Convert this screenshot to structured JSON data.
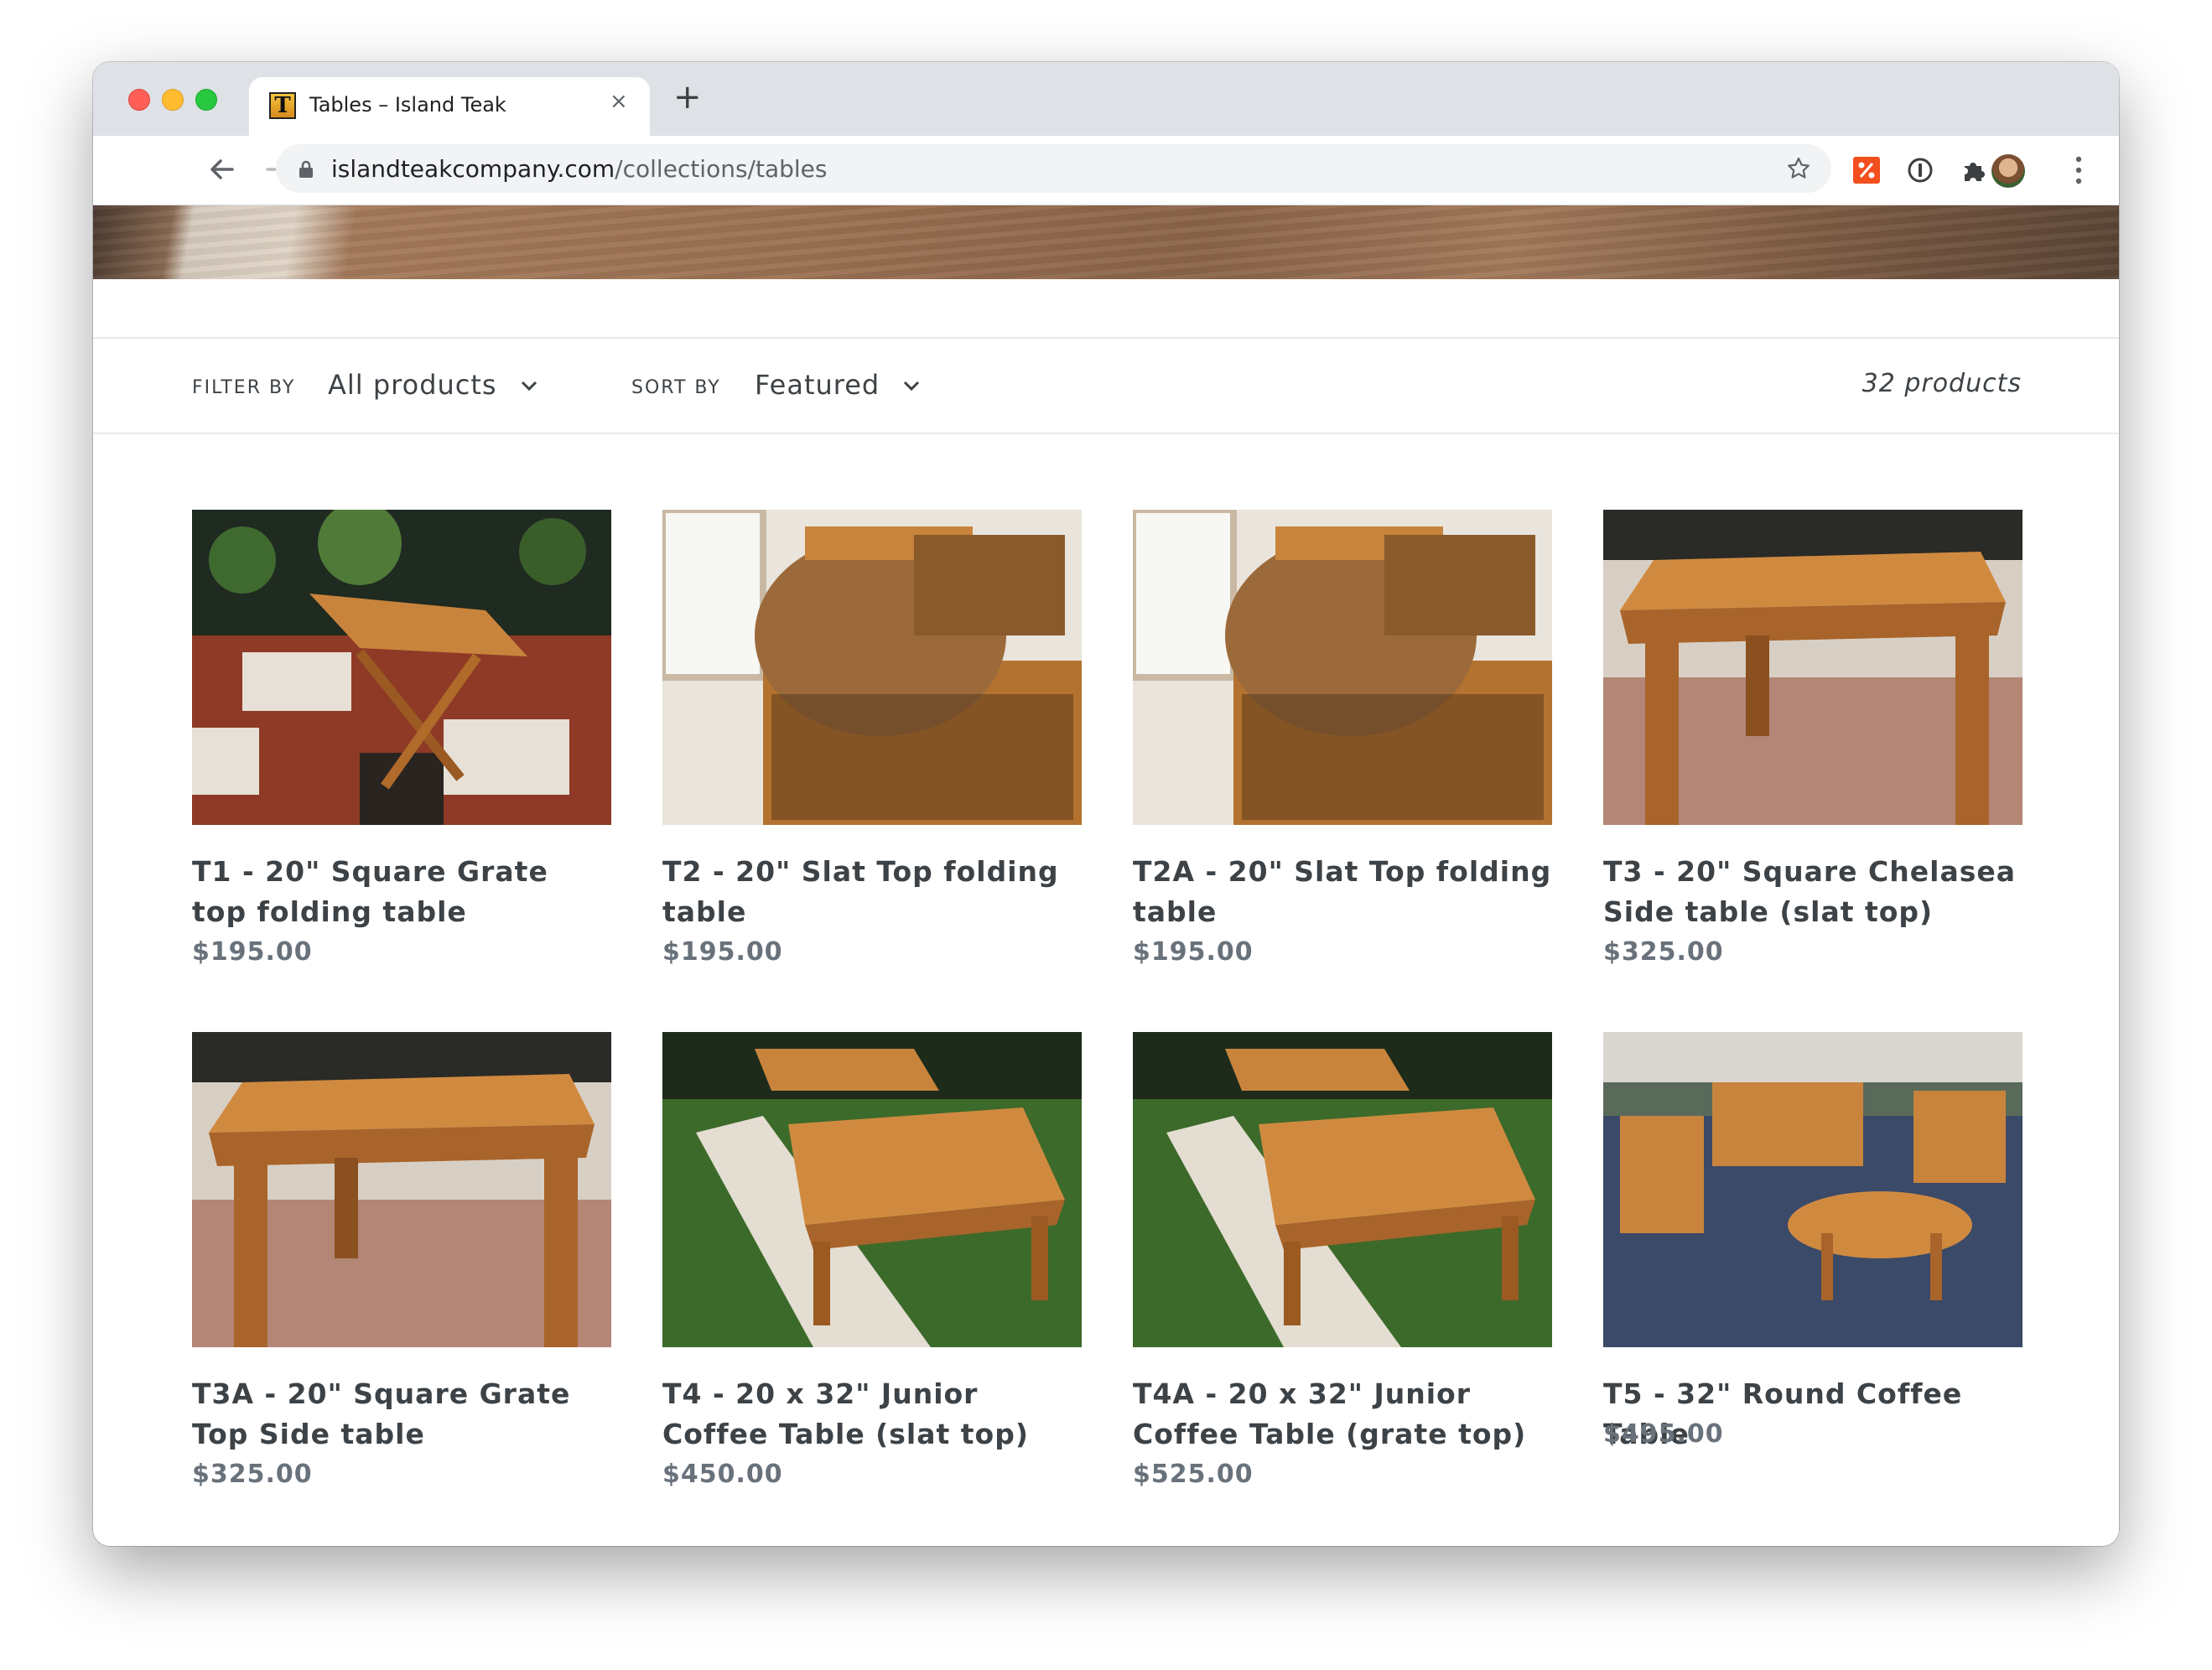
{
  "browser": {
    "tab_title": "Tables – Island Teak",
    "tab_close": "×",
    "new_tab": "+",
    "url_domain": "islandteakcompany.com",
    "url_path": "/collections/tables"
  },
  "filters": {
    "filter_label": "FILTER BY",
    "filter_value": "All products",
    "sort_label": "SORT BY",
    "sort_value": "Featured",
    "count": "32 products"
  },
  "products": [
    {
      "title": "T1 - 20\" Square Grate top folding table",
      "price": "$195.00"
    },
    {
      "title": "T2 - 20\" Slat Top folding table",
      "price": "$195.00"
    },
    {
      "title": "T2A - 20\" Slat Top folding table",
      "price": "$195.00"
    },
    {
      "title": "T3 - 20\" Square Chelasea Side table (slat top)",
      "price": "$325.00"
    },
    {
      "title": "T3A - 20\" Square Grate Top Side table",
      "price": "$325.00"
    },
    {
      "title": "T4 - 20 x 32\" Junior Coffee Table (slat top)",
      "price": "$450.00"
    },
    {
      "title": "T4A - 20 x 32\" Junior Coffee Table (grate top)",
      "price": "$525.00"
    },
    {
      "title": "T5 - 32\" Round Coffee Table",
      "price": "$495.00"
    }
  ],
  "colors": {
    "text": "#3d4246",
    "price": "#69727b",
    "teak": "#c8843c",
    "tab_strip": "#dee1e6"
  }
}
